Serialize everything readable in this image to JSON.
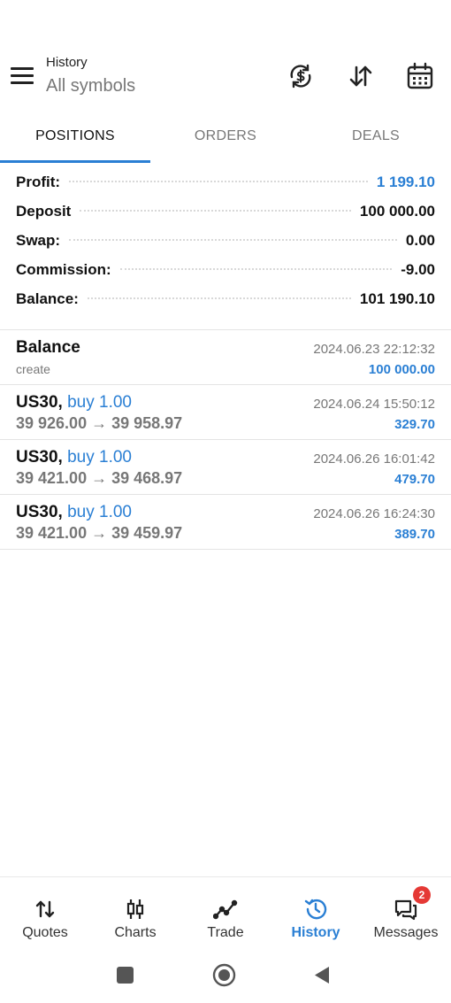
{
  "header": {
    "title": "History",
    "subtitle": "All symbols",
    "icons": [
      "menu-icon",
      "currency-exchange-icon",
      "sort-icon",
      "calendar-icon"
    ]
  },
  "tabs": [
    {
      "label": "POSITIONS",
      "active": true
    },
    {
      "label": "ORDERS",
      "active": false
    },
    {
      "label": "DEALS",
      "active": false
    }
  ],
  "summary": {
    "profit": {
      "label": "Profit:",
      "value": "1 199.10"
    },
    "deposit": {
      "label": "Deposit",
      "value": "100 000.00"
    },
    "swap": {
      "label": "Swap:",
      "value": "0.00"
    },
    "commission": {
      "label": "Commission:",
      "value": "-9.00"
    },
    "balance": {
      "label": "Balance:",
      "value": "101 190.10"
    }
  },
  "items": [
    {
      "symbol": "Balance",
      "type": "",
      "sub": "create",
      "time": "2024.06.23 22:12:32",
      "amount": "100 000.00"
    },
    {
      "symbol": "US30,",
      "type": "buy 1.00",
      "sub": "39 926.00 → 39 958.97",
      "time": "2024.06.24 15:50:12",
      "amount": "329.70"
    },
    {
      "symbol": "US30,",
      "type": "buy 1.00",
      "sub": "39 421.00 → 39 468.97",
      "time": "2024.06.26 16:01:42",
      "amount": "479.70"
    },
    {
      "symbol": "US30,",
      "type": "buy 1.00",
      "sub": "39 421.00 → 39 459.97",
      "time": "2024.06.26 16:24:30",
      "amount": "389.70"
    }
  ],
  "bottom_nav": [
    {
      "label": "Quotes",
      "icon": "quotes-arrows-icon",
      "active": false
    },
    {
      "label": "Charts",
      "icon": "candlestick-icon",
      "active": false
    },
    {
      "label": "Trade",
      "icon": "trend-line-icon",
      "active": false
    },
    {
      "label": "History",
      "icon": "history-icon",
      "active": true
    },
    {
      "label": "Messages",
      "icon": "messages-icon",
      "active": false,
      "badge": "2"
    }
  ],
  "colors": {
    "accent": "#2a7fd4",
    "badge": "#e53935",
    "muted": "#777777"
  }
}
